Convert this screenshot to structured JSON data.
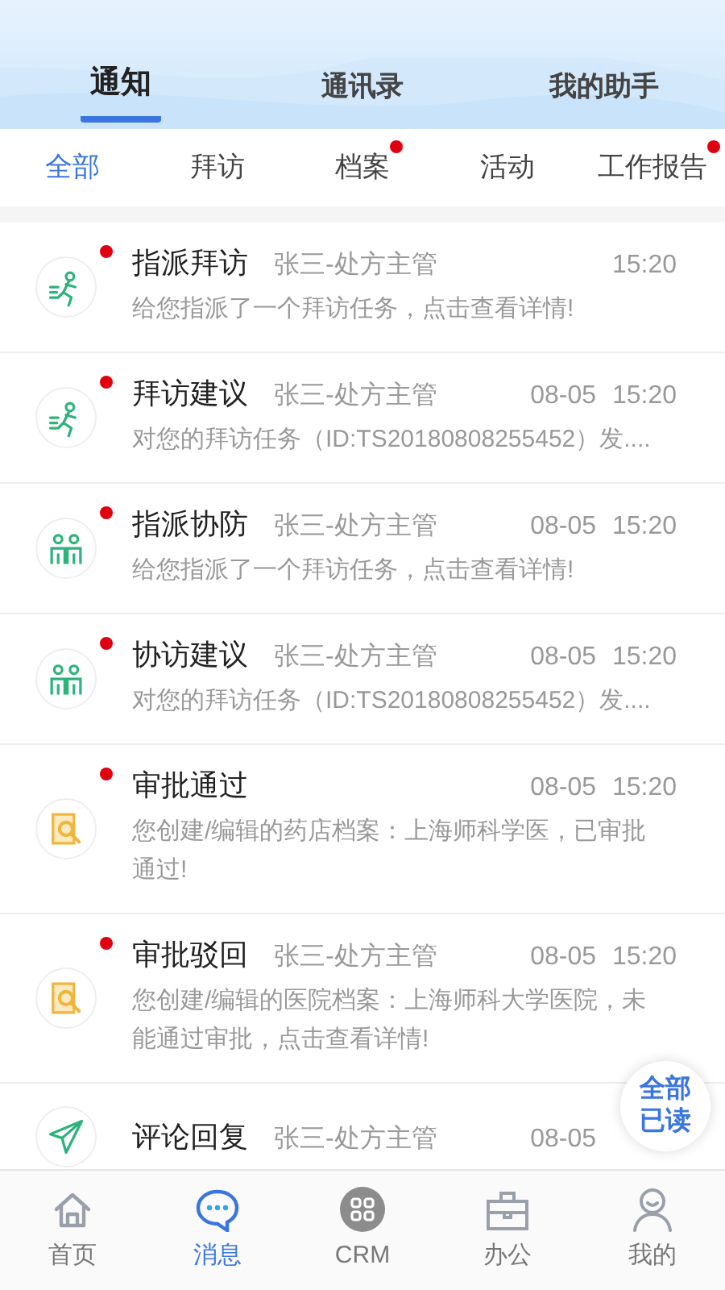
{
  "top_tabs": [
    {
      "label": "通知",
      "selected": true
    },
    {
      "label": "通讯录",
      "selected": false
    },
    {
      "label": "我的助手",
      "selected": false
    }
  ],
  "filters": [
    {
      "label": "全部",
      "selected": true,
      "unread": false
    },
    {
      "label": "拜访",
      "selected": false,
      "unread": false
    },
    {
      "label": "档案",
      "selected": false,
      "unread": true
    },
    {
      "label": "活动",
      "selected": false,
      "unread": false
    },
    {
      "label": "工作报告",
      "selected": false,
      "unread": true
    }
  ],
  "messages": [
    {
      "kind": "visit",
      "unread": true,
      "title": "指派拜访",
      "sender": "张三-处方主管",
      "time": "15:20",
      "text": "给您指派了一个拜访任务，点击查看详情!"
    },
    {
      "kind": "visit",
      "unread": true,
      "title": "拜访建议",
      "sender": "张三-处方主管",
      "date": "08-05",
      "time": "15:20",
      "text": "对您的拜访任务（ID:TS20180808255452）发...."
    },
    {
      "kind": "team",
      "unread": true,
      "title": "指派协防",
      "sender": "张三-处方主管",
      "date": "08-05",
      "time": "15:20",
      "text": "给您指派了一个拜访任务，点击查看详情!"
    },
    {
      "kind": "team",
      "unread": true,
      "title": "协访建议",
      "sender": "张三-处方主管",
      "date": "08-05",
      "time": "15:20",
      "text": "对您的拜访任务（ID:TS20180808255452）发...."
    },
    {
      "kind": "review",
      "unread": true,
      "title": "审批通过",
      "date": "08-05",
      "time": "15:20",
      "text": "您创建/编辑的药店档案：上海师科学医，已审批通过!"
    },
    {
      "kind": "review",
      "unread": true,
      "title": "审批驳回",
      "sender": "张三-处方主管",
      "date": "08-05",
      "time": "15:20",
      "text": "您创建/编辑的医院档案：上海师科大学医院，未能通过审批，点击查看详情!"
    },
    {
      "kind": "comment",
      "unread": false,
      "title": "评论回复",
      "sender": "张三-处方主管",
      "date": "08-05"
    }
  ],
  "mark_all_read": "全部已读",
  "nav": [
    {
      "kind": "home",
      "label": "首页",
      "selected": false
    },
    {
      "kind": "chat",
      "label": "消息",
      "selected": true
    },
    {
      "kind": "grid",
      "label": "CRM",
      "selected": false
    },
    {
      "kind": "case",
      "label": "办公",
      "selected": false
    },
    {
      "kind": "user",
      "label": "我的",
      "selected": false
    }
  ]
}
